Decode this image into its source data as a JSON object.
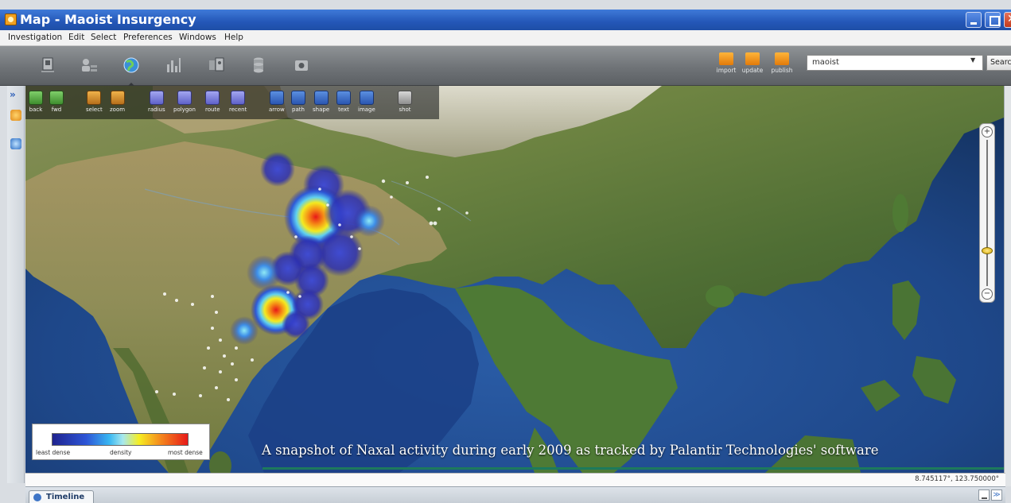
{
  "window": {
    "title": "Map - Maoist Insurgency",
    "icon": "map-app-icon"
  },
  "menu": {
    "items": [
      "Investigation",
      "Edit",
      "Select",
      "Preferences",
      "Windows",
      "Help"
    ]
  },
  "toolbar": {
    "views": [
      {
        "icon": "graph-view-icon"
      },
      {
        "icon": "people-view-icon"
      },
      {
        "icon": "globe-map-view-icon",
        "active": true
      },
      {
        "icon": "histogram-view-icon"
      },
      {
        "icon": "browser-view-icon"
      },
      {
        "icon": "database-view-icon"
      },
      {
        "icon": "media-view-icon"
      }
    ],
    "publish_buttons": [
      {
        "label": "import",
        "icon": "import-icon"
      },
      {
        "label": "update",
        "icon": "update-icon"
      },
      {
        "label": "publish",
        "icon": "publish-icon"
      }
    ],
    "search": {
      "value": "maoist",
      "button_label": "Search",
      "dropdown_glyph": "▼"
    }
  },
  "map_tools": [
    {
      "label": "back",
      "icon": "back-arrow-icon",
      "color": "green"
    },
    {
      "label": "fwd",
      "icon": "forward-arrow-icon",
      "color": "green"
    },
    {
      "label": "select",
      "icon": "select-icon",
      "color": "orange"
    },
    {
      "label": "zoom",
      "icon": "zoom-icon",
      "color": "orange"
    },
    {
      "label": "radius",
      "icon": "radius-icon",
      "color": "purple"
    },
    {
      "label": "polygon",
      "icon": "polygon-icon",
      "color": "purple"
    },
    {
      "label": "route",
      "icon": "route-icon",
      "color": "purple"
    },
    {
      "label": "recent",
      "icon": "recent-icon",
      "color": "purple"
    },
    {
      "label": "arrow",
      "icon": "draw-arrow-icon",
      "color": "blue"
    },
    {
      "label": "path",
      "icon": "draw-path-icon",
      "color": "blue"
    },
    {
      "label": "shape",
      "icon": "draw-shape-icon",
      "color": "blue"
    },
    {
      "label": "text",
      "icon": "draw-text-icon",
      "color": "blue"
    },
    {
      "label": "image",
      "icon": "draw-image-icon",
      "color": "blue"
    },
    {
      "label": "shot",
      "icon": "camera-icon",
      "color": "gray"
    }
  ],
  "zoom": {
    "zoom_in": "+",
    "zoom_out": "−",
    "level_fraction": 0.75
  },
  "legend": {
    "min_label": "least dense",
    "mid_label": "density",
    "max_label": "most dense",
    "colors": [
      "#1f238f",
      "#2d55d6",
      "#39b7f2",
      "#a7e8ee",
      "#f6ee22",
      "#f5881d",
      "#e71a1a"
    ]
  },
  "caption": "A snapshot of Naxal activity during early 2009 as tracked by Palantir Technologies' software",
  "status": {
    "coordinates": "8.745117°, 123.750000°"
  },
  "timeline": {
    "tab_label": "Timeline"
  },
  "colors": {
    "titlebar": "#2457b8",
    "toolbar": "#6f7377",
    "ocean": "#1e3f7a",
    "land": "#5d7a3a"
  }
}
